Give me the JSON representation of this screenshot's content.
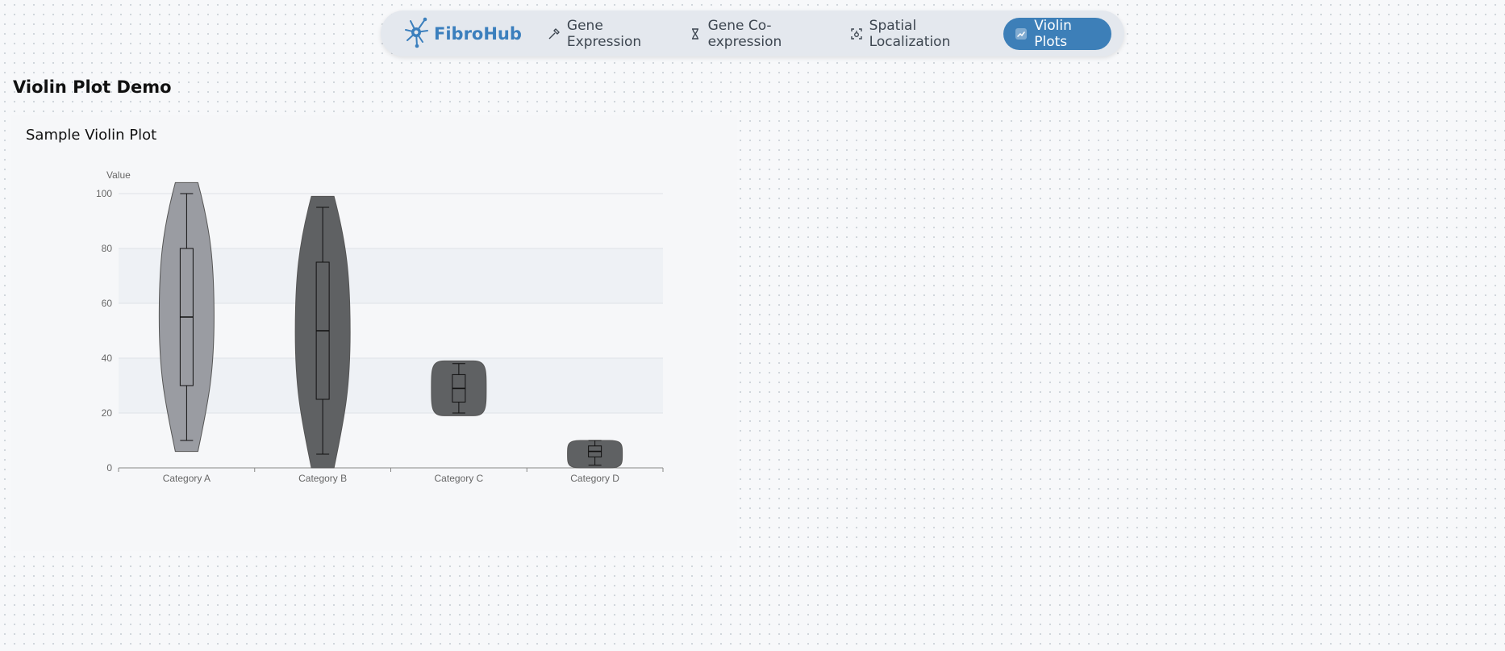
{
  "nav": {
    "brand": "FibroHub",
    "items": [
      {
        "label": "Gene Expression",
        "icon": "pipette-icon"
      },
      {
        "label": "Gene Co-expression",
        "icon": "hourglass-icon"
      },
      {
        "label": "Spatial Localization",
        "icon": "locate-icon"
      },
      {
        "label": "Violin Plots",
        "icon": "chart-icon",
        "active": true
      }
    ]
  },
  "page": {
    "title": "Violin Plot Demo"
  },
  "card": {
    "title": "Sample Violin Plot"
  },
  "colors": {
    "accent": "#3d7fb8",
    "brand": "#3b7fbd",
    "violin_light": "#9a9ca2",
    "violin_dark": "#5f6163"
  },
  "chart_data": {
    "type": "violin",
    "title": "Sample Violin Plot",
    "ylabel": "Value",
    "xlabel": "",
    "ylim": [
      0,
      100
    ],
    "yticks": [
      0,
      20,
      40,
      60,
      80,
      100
    ],
    "categories": [
      "Category A",
      "Category B",
      "Category C",
      "Category D"
    ],
    "violins": [
      {
        "category": "Category A",
        "min": 10,
        "q1": 30,
        "median": 55,
        "q3": 80,
        "max": 100,
        "extent_low": 6,
        "extent_high": 104,
        "color": "#9a9ca2"
      },
      {
        "category": "Category B",
        "min": 5,
        "q1": 25,
        "median": 50,
        "q3": 75,
        "max": 95,
        "extent_low": 0,
        "extent_high": 99,
        "color": "#5f6163"
      },
      {
        "category": "Category C",
        "min": 20,
        "q1": 24,
        "median": 29,
        "q3": 34,
        "max": 38,
        "extent_low": 19,
        "extent_high": 39,
        "color": "#5f6163"
      },
      {
        "category": "Category D",
        "min": 1,
        "q1": 4,
        "median": 6,
        "q3": 8,
        "max": 10,
        "extent_low": 0,
        "extent_high": 10,
        "color": "#5f6163"
      }
    ],
    "grid": true
  }
}
